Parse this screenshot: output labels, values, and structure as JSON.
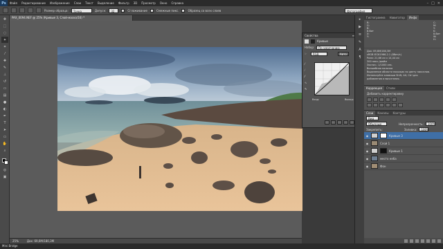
{
  "app": {
    "logo": "Ps",
    "menus": [
      "Файл",
      "Редактирование",
      "Изображение",
      "Слои",
      "Текст",
      "Выделение",
      "Фильтр",
      "3D",
      "Просмотр",
      "Окно",
      "Справка"
    ],
    "window_controls": [
      "–",
      "□",
      "✕"
    ]
  },
  "options": {
    "sample_label": "Размер образца:",
    "sample_value": "Точка",
    "tolerance_label": "Допуск:",
    "tolerance_value": "32",
    "antialias_label": "Сглаживание",
    "contiguous_label": "Смежные пикс.",
    "all_layers_label": "Образец со всех слоев",
    "workspace_value": "Фотография"
  },
  "document": {
    "tab_title": "PAX_0094.NEF @ 25% (Кривые 3, Слой-маска/16) *",
    "zoom": "25%",
    "doc_info": "Док: 69,6M/180,3M"
  },
  "bottom_bar": {
    "label": "Mini Bridge"
  },
  "properties": {
    "title": "Свойства",
    "section_label": "Кривые",
    "preset_label": "Набор:",
    "preset_value": "По умолчанию",
    "channel_value": "RGB",
    "auto_button": "Авто",
    "input_label": "Вход:",
    "output_label": "Выход:"
  },
  "info_panel": {
    "tabs": [
      "Гистограмма",
      "Навигатор",
      "Инфо"
    ],
    "left_lines": [
      "R:",
      "G:",
      "B:",
      "8-бит",
      "X:",
      "Y:"
    ],
    "right_lines": [
      "C:",
      "M:",
      "Y:",
      "K:",
      "8-бит",
      "W:",
      "H:"
    ],
    "description": [
      "Док: 69,6M/180,3M",
      "sRGB IEC61966-2.1 (8бит/к)",
      "Разм: 21,66 см x 14,44 см",
      "300 пикс./дюйм",
      "Экспоз.: 1/1000 сек.",
      "Волшебная палочка",
      "Выделение области похожих по цвету пикселов.",
      "Используйте клавиши Shift, Alt, Ctrl для",
      "добавления и вычитания."
    ]
  },
  "adjustments": {
    "tabs": [
      "Коррекция",
      "Стили"
    ],
    "title": "Добавить корректировку"
  },
  "layers": {
    "tabs": [
      "Слои",
      "Каналы",
      "Контуры"
    ],
    "kind_label": "Вид",
    "blend_mode": "Обычные",
    "opacity_label": "Непрозрачность:",
    "opacity_value": "100%",
    "lock_label": "Закрепить:",
    "fill_label": "Заливка:",
    "fill_value": "100%",
    "items": [
      {
        "name": "Кривые 3",
        "selected": true
      },
      {
        "name": "Слой 1",
        "selected": false
      },
      {
        "name": "Кривые 1",
        "selected": false
      },
      {
        "name": "место неба",
        "selected": false
      },
      {
        "name": "Фон",
        "selected": false
      }
    ]
  },
  "colors": {
    "accent": "#3f6fa6",
    "panel": "#535353",
    "chrome": "#2b2b2b"
  }
}
